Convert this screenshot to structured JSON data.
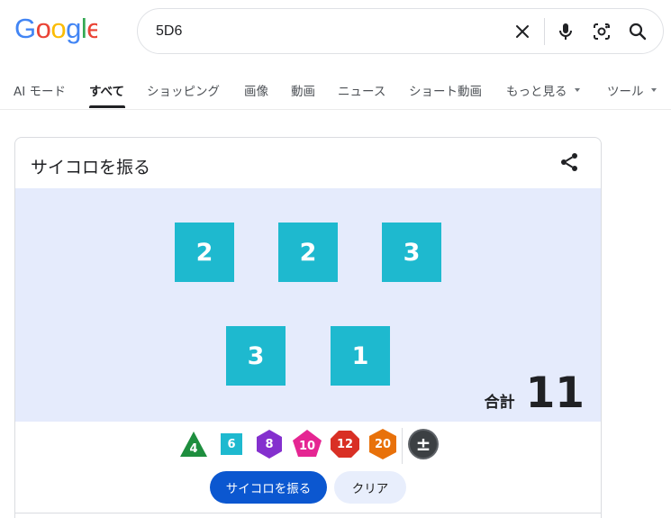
{
  "logo": {
    "text": "Google"
  },
  "search": {
    "query": "5D6"
  },
  "tabs": [
    {
      "label": "AI モード"
    },
    {
      "label": "すべて"
    },
    {
      "label": "ショッピング"
    },
    {
      "label": "画像"
    },
    {
      "label": "動画"
    },
    {
      "label": "ニュース"
    },
    {
      "label": "ショート動画"
    },
    {
      "label": "もっと見る"
    },
    {
      "label": "ツール"
    }
  ],
  "card": {
    "title": "サイコロを振る",
    "dice": [
      "2",
      "2",
      "3",
      "3",
      "1"
    ],
    "total_label": "合計",
    "total_value": "11",
    "die_types": [
      "4",
      "6",
      "8",
      "10",
      "12",
      "20",
      "±"
    ],
    "roll_label": "サイコロを振る",
    "clear_label": "クリア"
  },
  "colors": {
    "die_face": "#1eb9cf",
    "dice_area_bg": "#e5ebfc",
    "roll_button": "#0b57d0",
    "clear_button": "#e8eefc",
    "d4": "#1e8e3e",
    "d6": "#1eb9cf",
    "d8": "#8430ce",
    "d10": "#e52592",
    "d12": "#d93025",
    "d20": "#e8710a",
    "modifier": "#5f6368"
  }
}
